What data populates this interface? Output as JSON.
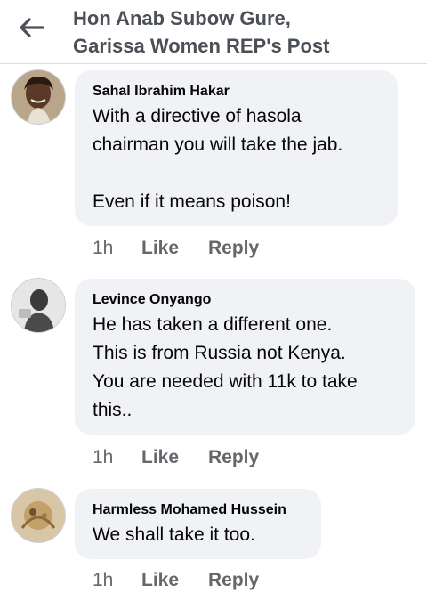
{
  "header": {
    "title_line1": "Hon Anab Subow Gure,",
    "title_line2": "Garissa Women REP's Post",
    "back_icon": "arrow-left-icon"
  },
  "comments": [
    {
      "author": "Sahal Ibrahim Hakar",
      "text": "With a directive of hasola\nchairman you will take the jab.\n\nEven if it means poison!",
      "time": "1h",
      "like": "Like",
      "reply": "Reply"
    },
    {
      "author": "Levince Onyango",
      "text": "He has taken a different one.\nThis is from Russia not Kenya.\nYou are needed with 11k to take\nthis..",
      "time": "1h",
      "like": "Like",
      "reply": "Reply"
    },
    {
      "author": "Harmless Mohamed Hussein",
      "text": "We shall take it too.",
      "time": "1h",
      "like": "Like",
      "reply": "Reply"
    }
  ],
  "colors": {
    "bubble": "#f0f2f5",
    "meta": "#65676b",
    "header_title": "#4b4f56"
  }
}
